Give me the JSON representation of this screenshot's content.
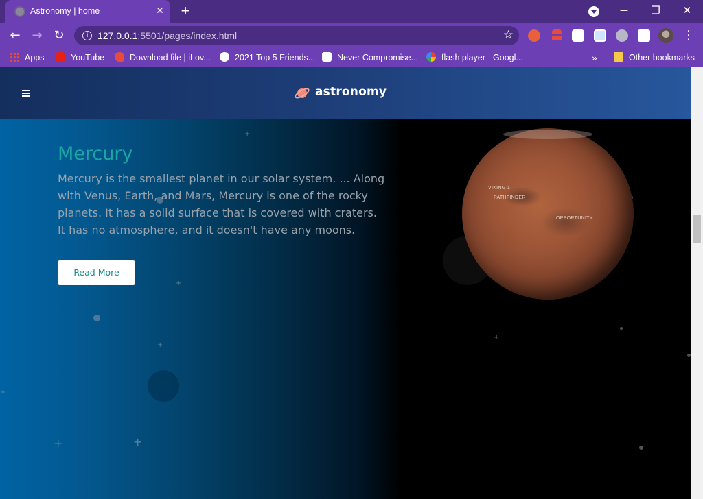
{
  "browser": {
    "tab": {
      "title": "Astronomy | home",
      "close_glyph": "✕"
    },
    "new_tab_glyph": "+",
    "window_controls": {
      "minimize": "─",
      "restore": "❐",
      "close": "✕"
    },
    "nav": {
      "back": "←",
      "forward": "→",
      "reload": "↻"
    },
    "url": {
      "host": "127.0.0.1",
      "rest": ":5501/pages/index.html"
    },
    "star_glyph": "☆",
    "menu_glyph": "⋮",
    "bookmarks": [
      {
        "label": "Apps",
        "icon": "apps-grid-icon"
      },
      {
        "label": "YouTube",
        "icon": "youtube-icon"
      },
      {
        "label": "Download file | iLov...",
        "icon": "heart-icon"
      },
      {
        "label": "2021 Top 5 Friends...",
        "icon": "globe-icon"
      },
      {
        "label": "Never Compromise...",
        "icon": "badge-icon"
      },
      {
        "label": "flash player - Googl...",
        "icon": "google-icon"
      }
    ],
    "bookmarks_overflow": "»",
    "other_bookmarks": "Other bookmarks"
  },
  "site": {
    "logo_text": "astronomy",
    "hero": {
      "title": "Mercury",
      "description": "Mercury is the smallest planet in our solar system. ... Along with Venus, Earth, and Mars, Mercury is one of the rocky planets. It has a solid surface that is covered with craters. It has no atmosphere, and it doesn't have any moons.",
      "button": "Read More"
    },
    "planet_labels": [
      "VIKING 1",
      "PATHFINDER",
      "OPPORTUNITY"
    ]
  },
  "colors": {
    "tabbar": "#4a2c83",
    "toolbar": "#6d3fb5",
    "title_accent": "#1aa6a4",
    "header_gradient_start": "#142f5e",
    "header_gradient_end": "#27579c"
  }
}
